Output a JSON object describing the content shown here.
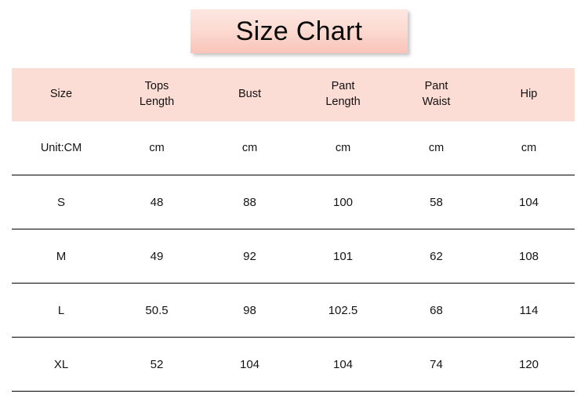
{
  "title": {
    "text": "Size Chart"
  },
  "colors": {
    "header_band": "#FCDDD5",
    "banner_top": "#FDE7E1",
    "banner_bottom": "#F9C4B9",
    "rule": "#000000",
    "text": "#111111",
    "background": "#FFFFFF"
  },
  "table": {
    "headers": [
      {
        "lines": [
          "Size"
        ]
      },
      {
        "lines": [
          "Tops",
          "Length"
        ]
      },
      {
        "lines": [
          "Bust"
        ]
      },
      {
        "lines": [
          "Pant",
          "Length"
        ]
      },
      {
        "lines": [
          "Pant",
          "Waist"
        ]
      },
      {
        "lines": [
          "Hip"
        ]
      }
    ],
    "rows": [
      {
        "label": "Unit:CM",
        "values": [
          "cm",
          "cm",
          "cm",
          "cm",
          "cm"
        ]
      },
      {
        "label": "S",
        "values": [
          "48",
          "88",
          "100",
          "58",
          "104"
        ]
      },
      {
        "label": "M",
        "values": [
          "49",
          "92",
          "101",
          "62",
          "108"
        ]
      },
      {
        "label": "L",
        "values": [
          "50.5",
          "98",
          "102.5",
          "68",
          "114"
        ]
      },
      {
        "label": "XL",
        "values": [
          "52",
          "104",
          "104",
          "74",
          "120"
        ]
      }
    ]
  }
}
